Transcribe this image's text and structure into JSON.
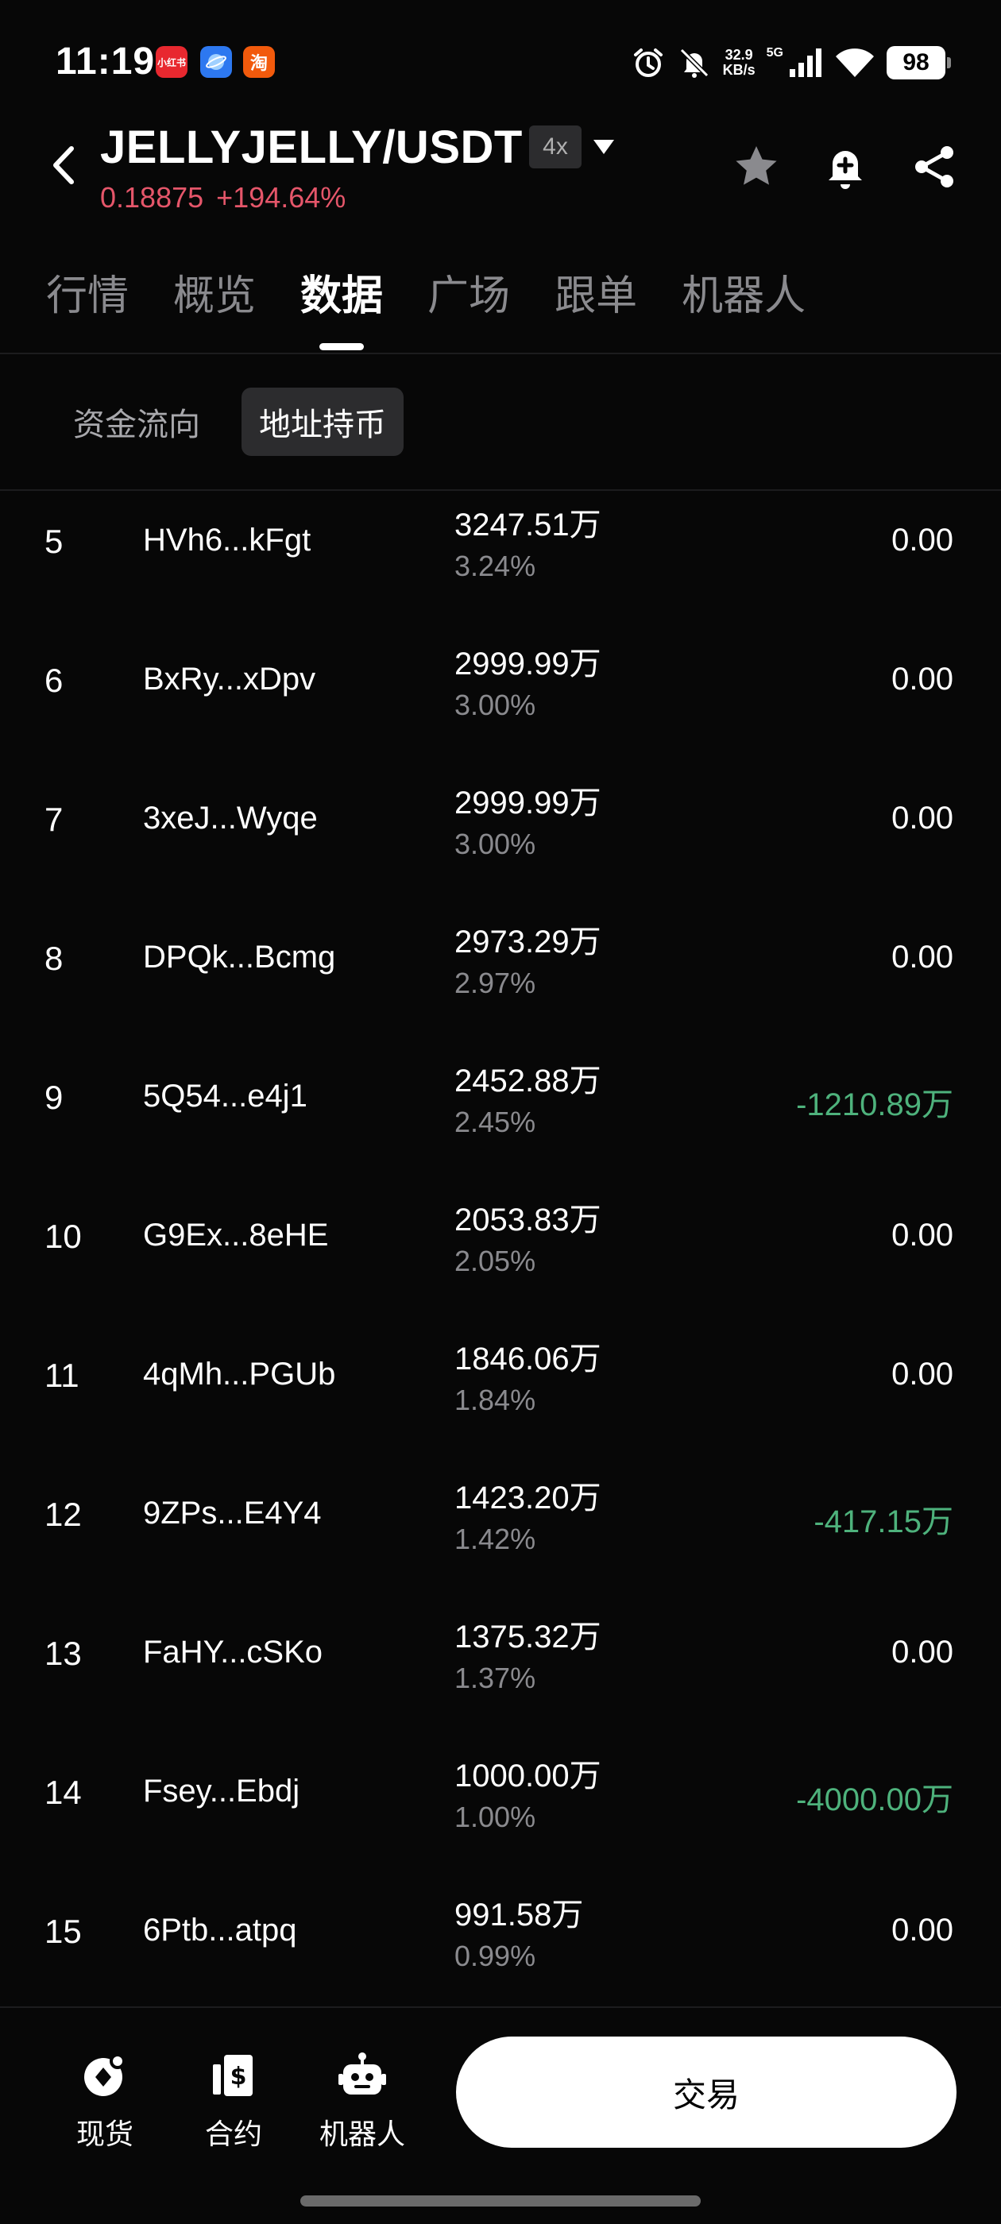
{
  "status_bar": {
    "time": "11:19",
    "app_badges": [
      "小红书",
      "",
      "淘"
    ],
    "net_speed_value": "32.9",
    "net_speed_unit": "KB/s",
    "network": "5G",
    "battery": "98"
  },
  "header": {
    "pair": "JELLYJELLY/USDT",
    "leverage": "4x",
    "price": "0.18875",
    "change": "+194.64%",
    "price_color": "#e5566a"
  },
  "main_tabs": [
    {
      "label": "行情",
      "active": false
    },
    {
      "label": "概览",
      "active": false
    },
    {
      "label": "数据",
      "active": true
    },
    {
      "label": "广场",
      "active": false
    },
    {
      "label": "跟单",
      "active": false
    },
    {
      "label": "机器人",
      "active": false
    }
  ],
  "sub_tabs": [
    {
      "label": "资金流向",
      "active": false
    },
    {
      "label": "地址持币",
      "active": true
    }
  ],
  "holders": [
    {
      "rank": "5",
      "address": "HVh6...kFgt",
      "amount": "3247.51万",
      "percent": "3.24%",
      "change": "0.00",
      "negative": false
    },
    {
      "rank": "6",
      "address": "BxRy...xDpv",
      "amount": "2999.99万",
      "percent": "3.00%",
      "change": "0.00",
      "negative": false
    },
    {
      "rank": "7",
      "address": "3xeJ...Wyqe",
      "amount": "2999.99万",
      "percent": "3.00%",
      "change": "0.00",
      "negative": false
    },
    {
      "rank": "8",
      "address": "DPQk...Bcmg",
      "amount": "2973.29万",
      "percent": "2.97%",
      "change": "0.00",
      "negative": false
    },
    {
      "rank": "9",
      "address": "5Q54...e4j1",
      "amount": "2452.88万",
      "percent": "2.45%",
      "change": "-1210.89万",
      "negative": true
    },
    {
      "rank": "10",
      "address": "G9Ex...8eHE",
      "amount": "2053.83万",
      "percent": "2.05%",
      "change": "0.00",
      "negative": false
    },
    {
      "rank": "11",
      "address": "4qMh...PGUb",
      "amount": "1846.06万",
      "percent": "1.84%",
      "change": "0.00",
      "negative": false
    },
    {
      "rank": "12",
      "address": "9ZPs...E4Y4",
      "amount": "1423.20万",
      "percent": "1.42%",
      "change": "-417.15万",
      "negative": true
    },
    {
      "rank": "13",
      "address": "FaHY...cSKo",
      "amount": "1375.32万",
      "percent": "1.37%",
      "change": "0.00",
      "negative": false
    },
    {
      "rank": "14",
      "address": "Fsey...Ebdj",
      "amount": "1000.00万",
      "percent": "1.00%",
      "change": "-4000.00万",
      "negative": true
    },
    {
      "rank": "15",
      "address": "6Ptb...atpq",
      "amount": "991.58万",
      "percent": "0.99%",
      "change": "0.00",
      "negative": false
    }
  ],
  "bottom_nav": {
    "items": [
      {
        "label": "现货",
        "icon": "spot-icon"
      },
      {
        "label": "合约",
        "icon": "contract-icon"
      },
      {
        "label": "机器人",
        "icon": "robot-icon"
      }
    ],
    "trade_label": "交易"
  },
  "colors": {
    "background": "#070707",
    "negative_change": "#4eb27c",
    "accent_white": "#ffffff"
  }
}
